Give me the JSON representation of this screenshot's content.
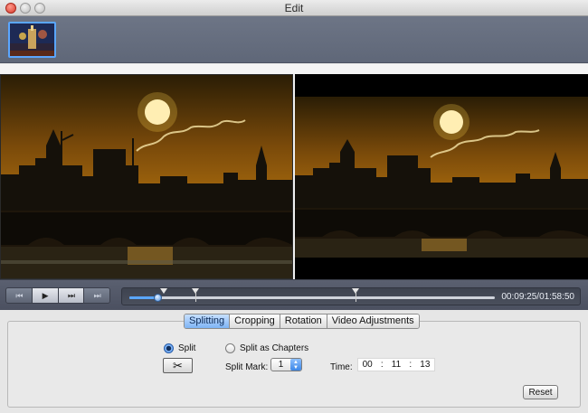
{
  "window": {
    "title": "Edit"
  },
  "thumbnails": [
    {
      "selected": true,
      "icon": "video-thumbnail-icon"
    }
  ],
  "transport": {
    "buttons": [
      {
        "name": "skip-back-button",
        "glyph": "⏮"
      },
      {
        "name": "play-button",
        "glyph": "▶"
      },
      {
        "name": "fast-forward-button",
        "glyph": "⏭"
      },
      {
        "name": "skip-forward-button",
        "glyph": "⏭"
      }
    ],
    "timecode": "00:09:25/01:58:50",
    "playhead_fraction": 0.08,
    "split_mark_fractions": [
      0.18,
      0.62
    ]
  },
  "tabs": [
    {
      "label": "Splitting",
      "active": true
    },
    {
      "label": "Cropping",
      "active": false
    },
    {
      "label": "Rotation",
      "active": false
    },
    {
      "label": "Video Adjustments",
      "active": false
    }
  ],
  "splitting": {
    "radio_split_label": "Split",
    "radio_chapters_label": "Split as Chapters",
    "radio_selected": "split",
    "split_mark_label": "Split Mark:",
    "split_mark_value": "1",
    "time_label": "Time:",
    "time_hours": "00",
    "time_sep": ":",
    "time_minutes": "11",
    "time_seconds": "13",
    "scissors_glyph": "✂",
    "reset_label": "Reset"
  },
  "colors": {
    "accent": "#5aa6ff",
    "strip": "#6d7586",
    "transport": "#525868"
  }
}
